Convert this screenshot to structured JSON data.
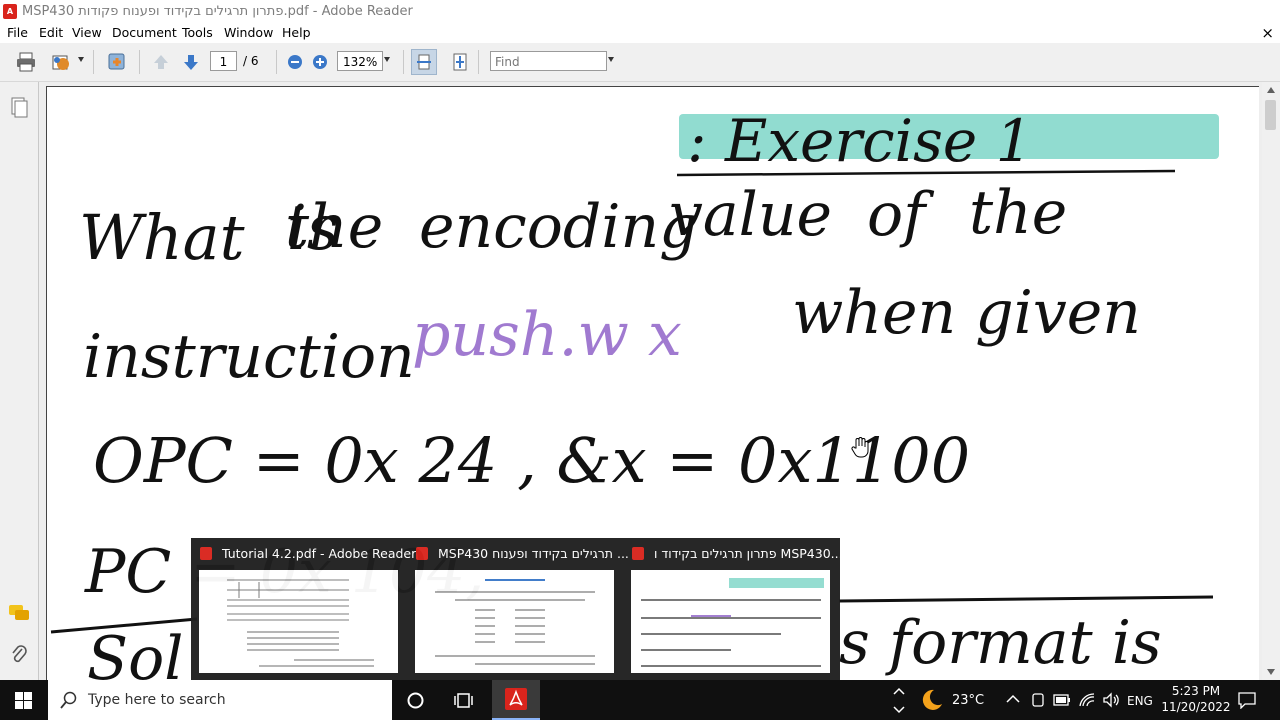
{
  "window": {
    "title": "MSP430 פתרון תרגילים בקידוד ופענוח פקודות.pdf - Adobe Reader"
  },
  "menu": {
    "items": [
      "File",
      "Edit",
      "View",
      "Document",
      "Tools",
      "Window",
      "Help"
    ],
    "close_glyph": "×"
  },
  "toolbar": {
    "page_current": "1",
    "page_total": "/ 6",
    "zoom": "132%",
    "find_placeholder": "Find"
  },
  "document": {
    "heading": ": Exercise 1",
    "line1": [
      "What",
      "is",
      "the",
      "encoding",
      "value",
      "of",
      "the"
    ],
    "line2_a": "instruction",
    "line2_instr": "push.w x",
    "line2_b": "when given",
    "line3": "OPC = 0x 24 , &x = 0x1100",
    "line4": "PC = 0x 104,",
    "line5_a": "Sol",
    "line5_b": "s format is",
    "accent_color": "#91dcd0",
    "instr_color": "#a07ad0"
  },
  "previews": [
    {
      "title": "Tutorial 4.2.pdf - Adobe Reader"
    },
    {
      "title": "MSP430 תרגילים בקידוד ופענוח ..."
    },
    {
      "title": "פתרון תרגילים בקידוד ו MSP430..."
    }
  ],
  "taskbar": {
    "search_placeholder": "Type here to search",
    "weather": "23°C",
    "lang": "ENG",
    "time": "5:23 PM",
    "date": "11/20/2022"
  }
}
